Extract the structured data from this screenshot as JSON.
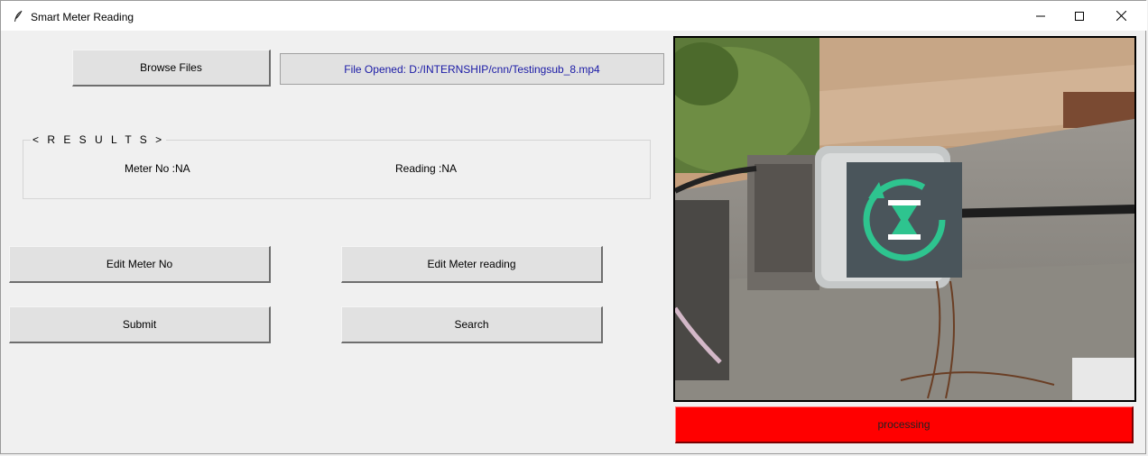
{
  "window": {
    "title": "Smart Meter Reading",
    "icon": "feather-icon"
  },
  "file": {
    "browse_label": "Browse Files",
    "opened_text": "File Opened: D:/INTERNSHIP/cnn/Testingsub_8.mp4"
  },
  "results": {
    "legend": "< R E S U L T S >",
    "meter_no": "Meter No :NA",
    "reading": "Reading :NA"
  },
  "actions": {
    "edit_meter_no": "Edit Meter No",
    "edit_meter_reading": "Edit Meter reading",
    "submit": "Submit",
    "search": "Search"
  },
  "video": {
    "overlay_icon": "hourglass-refresh-icon"
  },
  "status": {
    "text": "processing",
    "color": "#ff0000"
  }
}
